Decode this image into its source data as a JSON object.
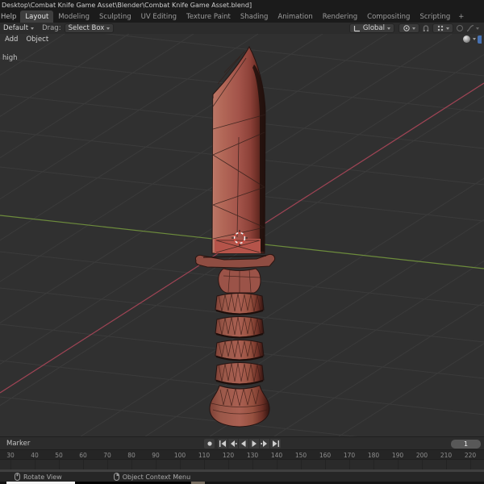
{
  "window": {
    "title": "Desktop\\Combat Knife Game Asset\\Blender\\Combat Knife Game Asset.blend]"
  },
  "topbar": {
    "help_menu": "Help",
    "tabs": [
      {
        "label": "Layout",
        "active": true
      },
      {
        "label": "Modeling"
      },
      {
        "label": "Sculpting"
      },
      {
        "label": "UV Editing"
      },
      {
        "label": "Texture Paint"
      },
      {
        "label": "Shading"
      },
      {
        "label": "Animation"
      },
      {
        "label": "Rendering"
      },
      {
        "label": "Compositing"
      },
      {
        "label": "Scripting"
      }
    ],
    "new_workspace_button": "+"
  },
  "tool_settings": {
    "tool_preset": "Default",
    "drag_label": "Drag:",
    "drag_tool": "Select Box",
    "orientation": "Global",
    "icons": [
      "orientation-axes-icon",
      "pivot-point-icon",
      "snap-magnet-icon",
      "snap-target-grid-icon",
      "proportional-editing-icon",
      "falloff-curve-icon"
    ]
  },
  "viewport": {
    "menus": {
      "add": "Add",
      "object": "Object"
    },
    "active_object": "high",
    "header_icons": [
      "viewport-shading-sphere-icon",
      "editor-corner-icon"
    ],
    "colors": {
      "background": "#303030",
      "grid_line": "#3b3b3b",
      "x_axis": "#a04455",
      "y_axis": "#6d8c3c",
      "model_base": "#a5584c",
      "cursor_red": "#d94a3f"
    }
  },
  "timeline": {
    "marker_menu": "Marker",
    "current_frame": "1",
    "ticks": [
      "30",
      "40",
      "50",
      "60",
      "70",
      "80",
      "90",
      "100",
      "110",
      "120",
      "130",
      "140",
      "150",
      "160",
      "170",
      "180",
      "190",
      "200",
      "210",
      "220"
    ],
    "playback_buttons": [
      "auto-keyframe",
      "jump-to-start",
      "previous-keyframe",
      "play-reverse",
      "play",
      "next-keyframe",
      "jump-to-end"
    ]
  },
  "status_bar": {
    "left": {
      "icon": "mouse-middle-drag-icon",
      "label": "Rotate View"
    },
    "right": {
      "icon": "mouse-right-click-icon",
      "label": "Object Context Menu"
    }
  }
}
